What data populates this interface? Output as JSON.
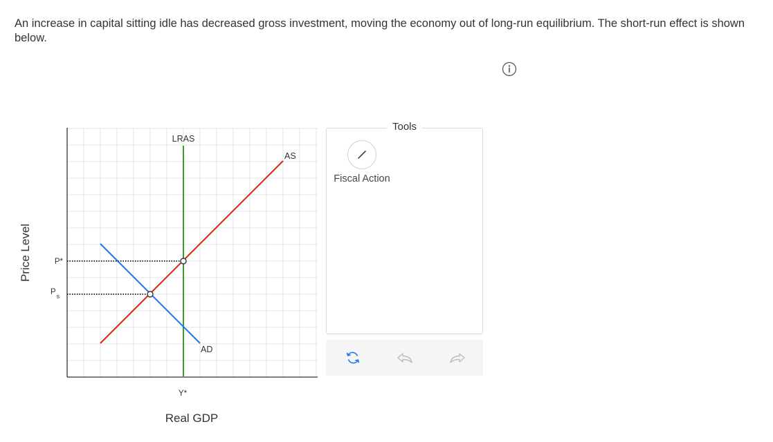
{
  "prompt": "An increase in capital sitting idle has decreased gross investment, moving the economy out of long-run equilibrium. The short-run effect is shown below.",
  "info_icon": "info-icon",
  "graph": {
    "y_axis_label": "Price Level",
    "x_axis_label": "Real GDP",
    "curves": {
      "lras": "LRAS",
      "as": "AS",
      "ad": "AD"
    },
    "price_labels": {
      "p_star": "P*",
      "p_s_main": "P",
      "p_s_sub": "s"
    },
    "output_label": "Y*",
    "colors": {
      "lras": "#3a9a2a",
      "as": "#e0220f",
      "ad": "#1a73e8",
      "grid": "#e3e3e3",
      "axis": "#333333"
    }
  },
  "tools": {
    "title": "Tools",
    "fiscal_label": "Fiscal Action",
    "fiscal_icon": "pencil-line-icon"
  },
  "action_bar": {
    "reset_icon": "reset-icon",
    "undo_icon": "undo-icon",
    "redo_icon": "redo-icon"
  }
}
